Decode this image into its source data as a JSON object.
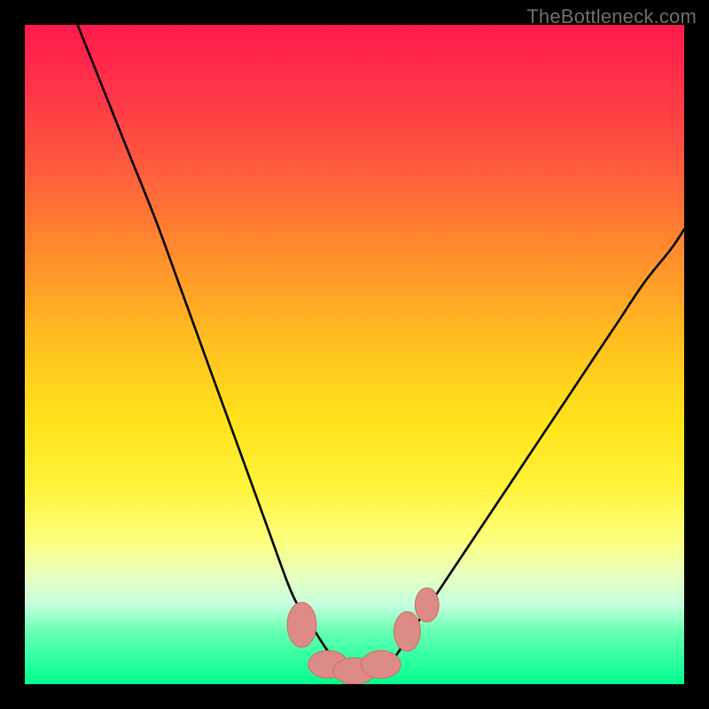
{
  "watermark": "TheBottleneck.com",
  "colors": {
    "frame": "#000000",
    "curve_stroke": "#000000",
    "marker_fill": "#dd8b86",
    "marker_stroke": "#cf6a64"
  },
  "chart_data": {
    "type": "line",
    "title": "",
    "xlabel": "",
    "ylabel": "",
    "xlim": [
      0,
      100
    ],
    "ylim": [
      0,
      100
    ],
    "grid": false,
    "legend": false,
    "annotations": [
      "TheBottleneck.com"
    ],
    "background_gradient": {
      "direction": "vertical",
      "stops": [
        {
          "pos": 0.0,
          "color": "#ff1a4d"
        },
        {
          "pos": 0.2,
          "color": "#ff5540"
        },
        {
          "pos": 0.48,
          "color": "#ffbf1f"
        },
        {
          "pos": 0.7,
          "color": "#fff23a"
        },
        {
          "pos": 0.88,
          "color": "#c5ffe0"
        },
        {
          "pos": 1.0,
          "color": "#00ff8f"
        }
      ]
    },
    "series": [
      {
        "name": "bottleneck-curve",
        "x": [
          8,
          12,
          16,
          20,
          24,
          28,
          32,
          36,
          40,
          42,
          44,
          46,
          48,
          50,
          52,
          54,
          56,
          58,
          62,
          66,
          70,
          74,
          78,
          82,
          86,
          90,
          94,
          98,
          100
        ],
        "y": [
          100,
          90,
          80,
          70,
          59,
          48,
          37,
          26,
          15,
          11,
          8,
          5,
          3,
          2,
          2,
          3,
          4,
          7,
          13,
          19,
          25,
          31,
          37,
          43,
          49,
          55,
          61,
          66,
          69
        ]
      }
    ],
    "markers": [
      {
        "name": "min-cluster-left",
        "x": 42,
        "y": 9,
        "rx": 2.2,
        "ry": 3.4
      },
      {
        "name": "min-cluster-mid-a",
        "x": 46,
        "y": 3,
        "rx": 3.0,
        "ry": 2.1
      },
      {
        "name": "min-cluster-mid-b",
        "x": 50,
        "y": 2,
        "rx": 3.2,
        "ry": 2.0
      },
      {
        "name": "min-cluster-mid-c",
        "x": 54,
        "y": 3,
        "rx": 3.0,
        "ry": 2.1
      },
      {
        "name": "min-cluster-right",
        "x": 58,
        "y": 8,
        "rx": 2.0,
        "ry": 3.0
      },
      {
        "name": "min-cluster-far-r",
        "x": 61,
        "y": 12,
        "rx": 1.8,
        "ry": 2.6
      }
    ]
  }
}
